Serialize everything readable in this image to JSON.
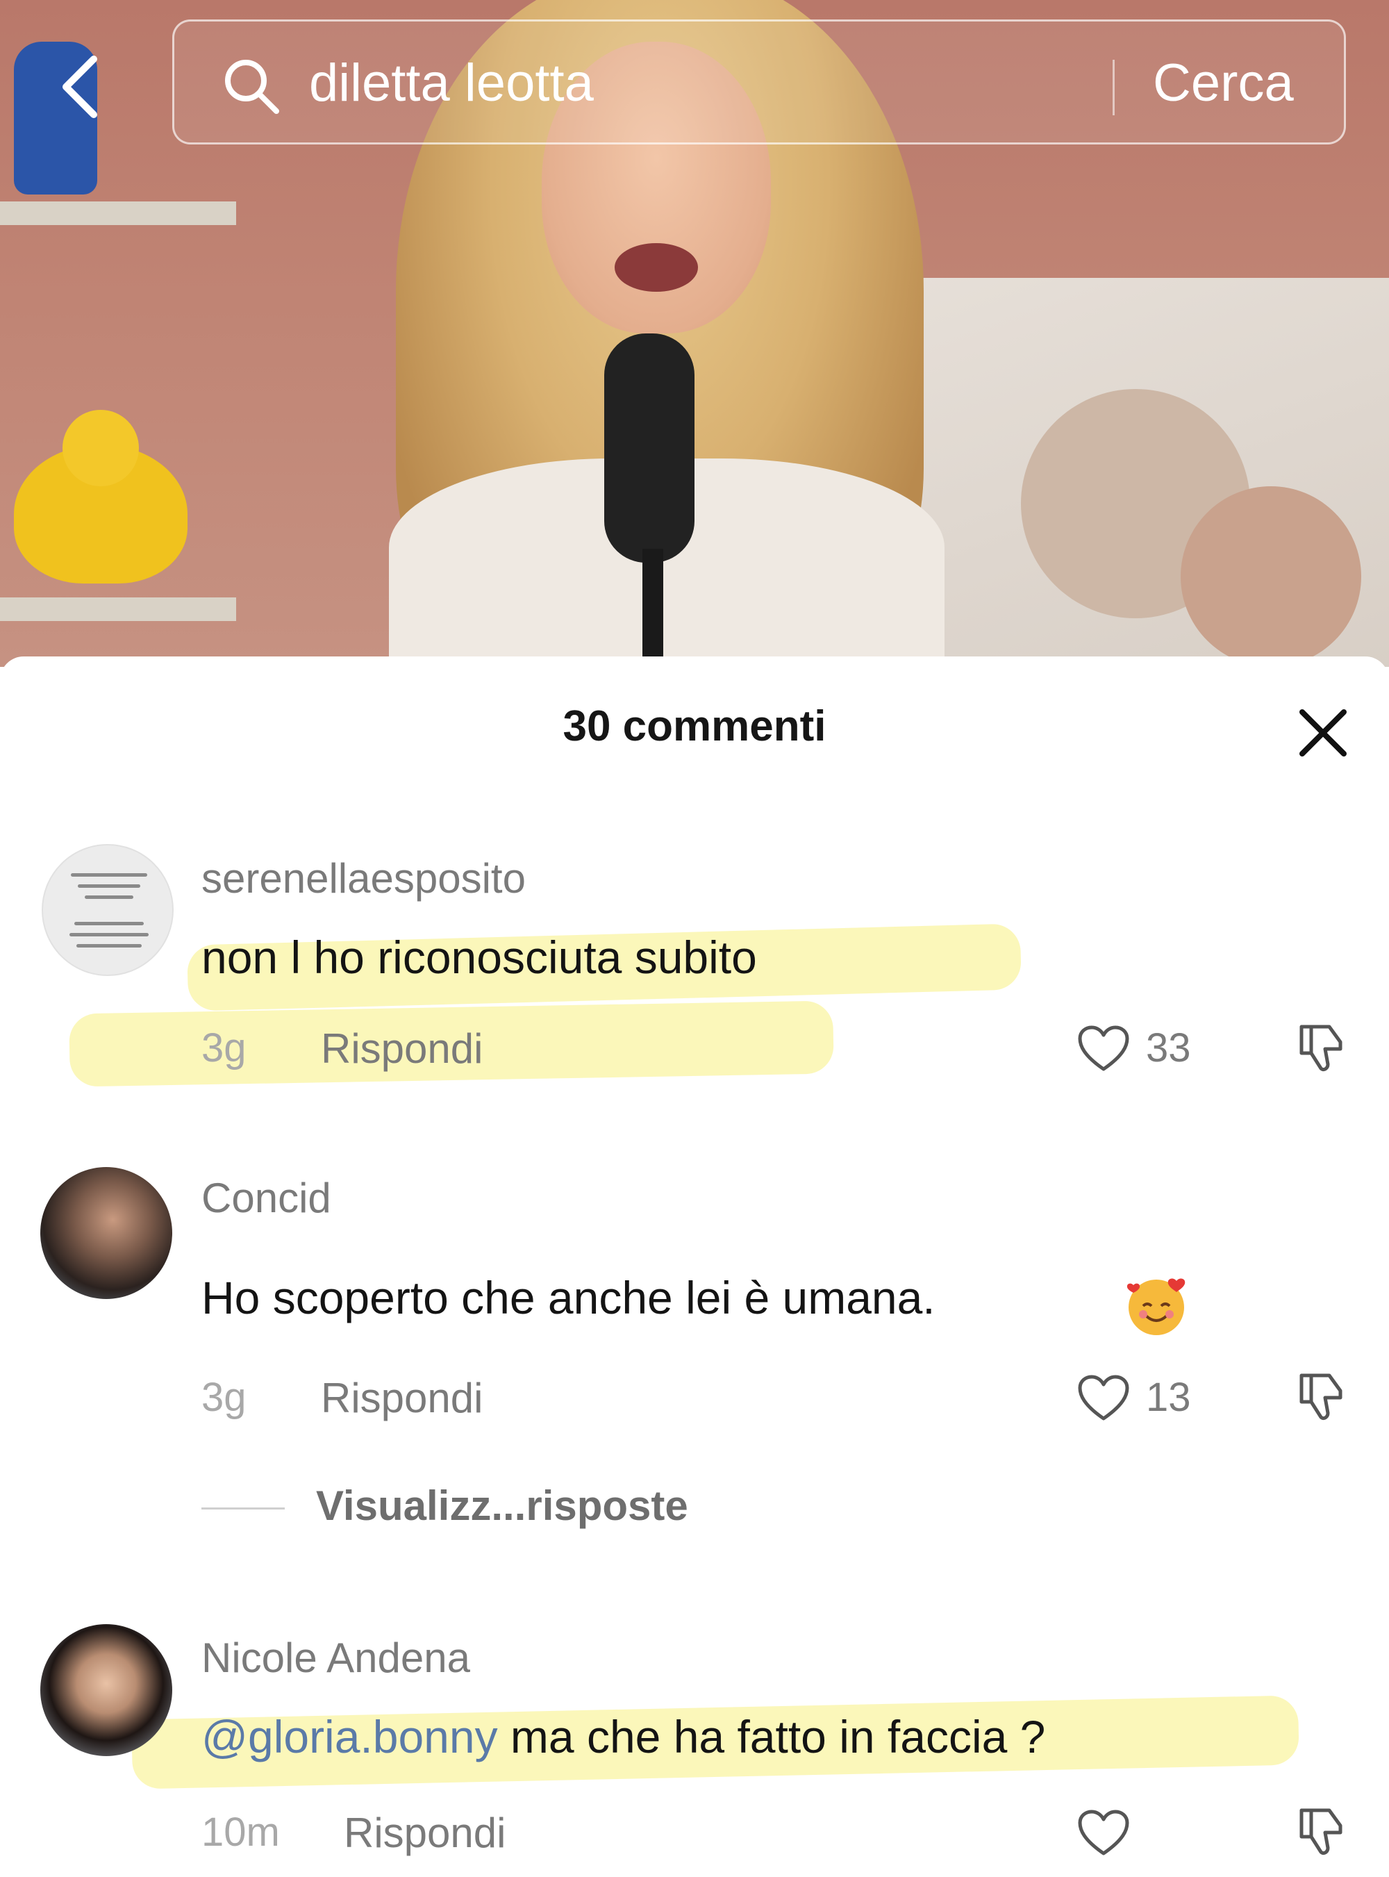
{
  "search": {
    "query": "diletta leotta",
    "submit_label": "Cerca"
  },
  "comments_sheet": {
    "title": "30 commenti",
    "view_replies_label": "Visualizz...risposte",
    "comments": [
      {
        "username": "serenellaesposito",
        "text": "non l ho riconosciuta subito",
        "time": "3g",
        "reply_label": "Rispondi",
        "likes": "33"
      },
      {
        "username": "Concid",
        "text": "Ho scoperto che anche lei è umana.",
        "emoji": "smiling-face-with-hearts",
        "time": "3g",
        "reply_label": "Rispondi",
        "likes": "13"
      },
      {
        "username": "Nicole Andena",
        "mention": "@gloria.bonny",
        "text": " ma che ha fatto in faccia ?",
        "time": "10m",
        "reply_label": "Rispondi",
        "likes": ""
      }
    ]
  },
  "colors": {
    "highlight": "#f8f082",
    "mention": "#5a7aa8",
    "secondary_text": "#7a7a7a"
  }
}
